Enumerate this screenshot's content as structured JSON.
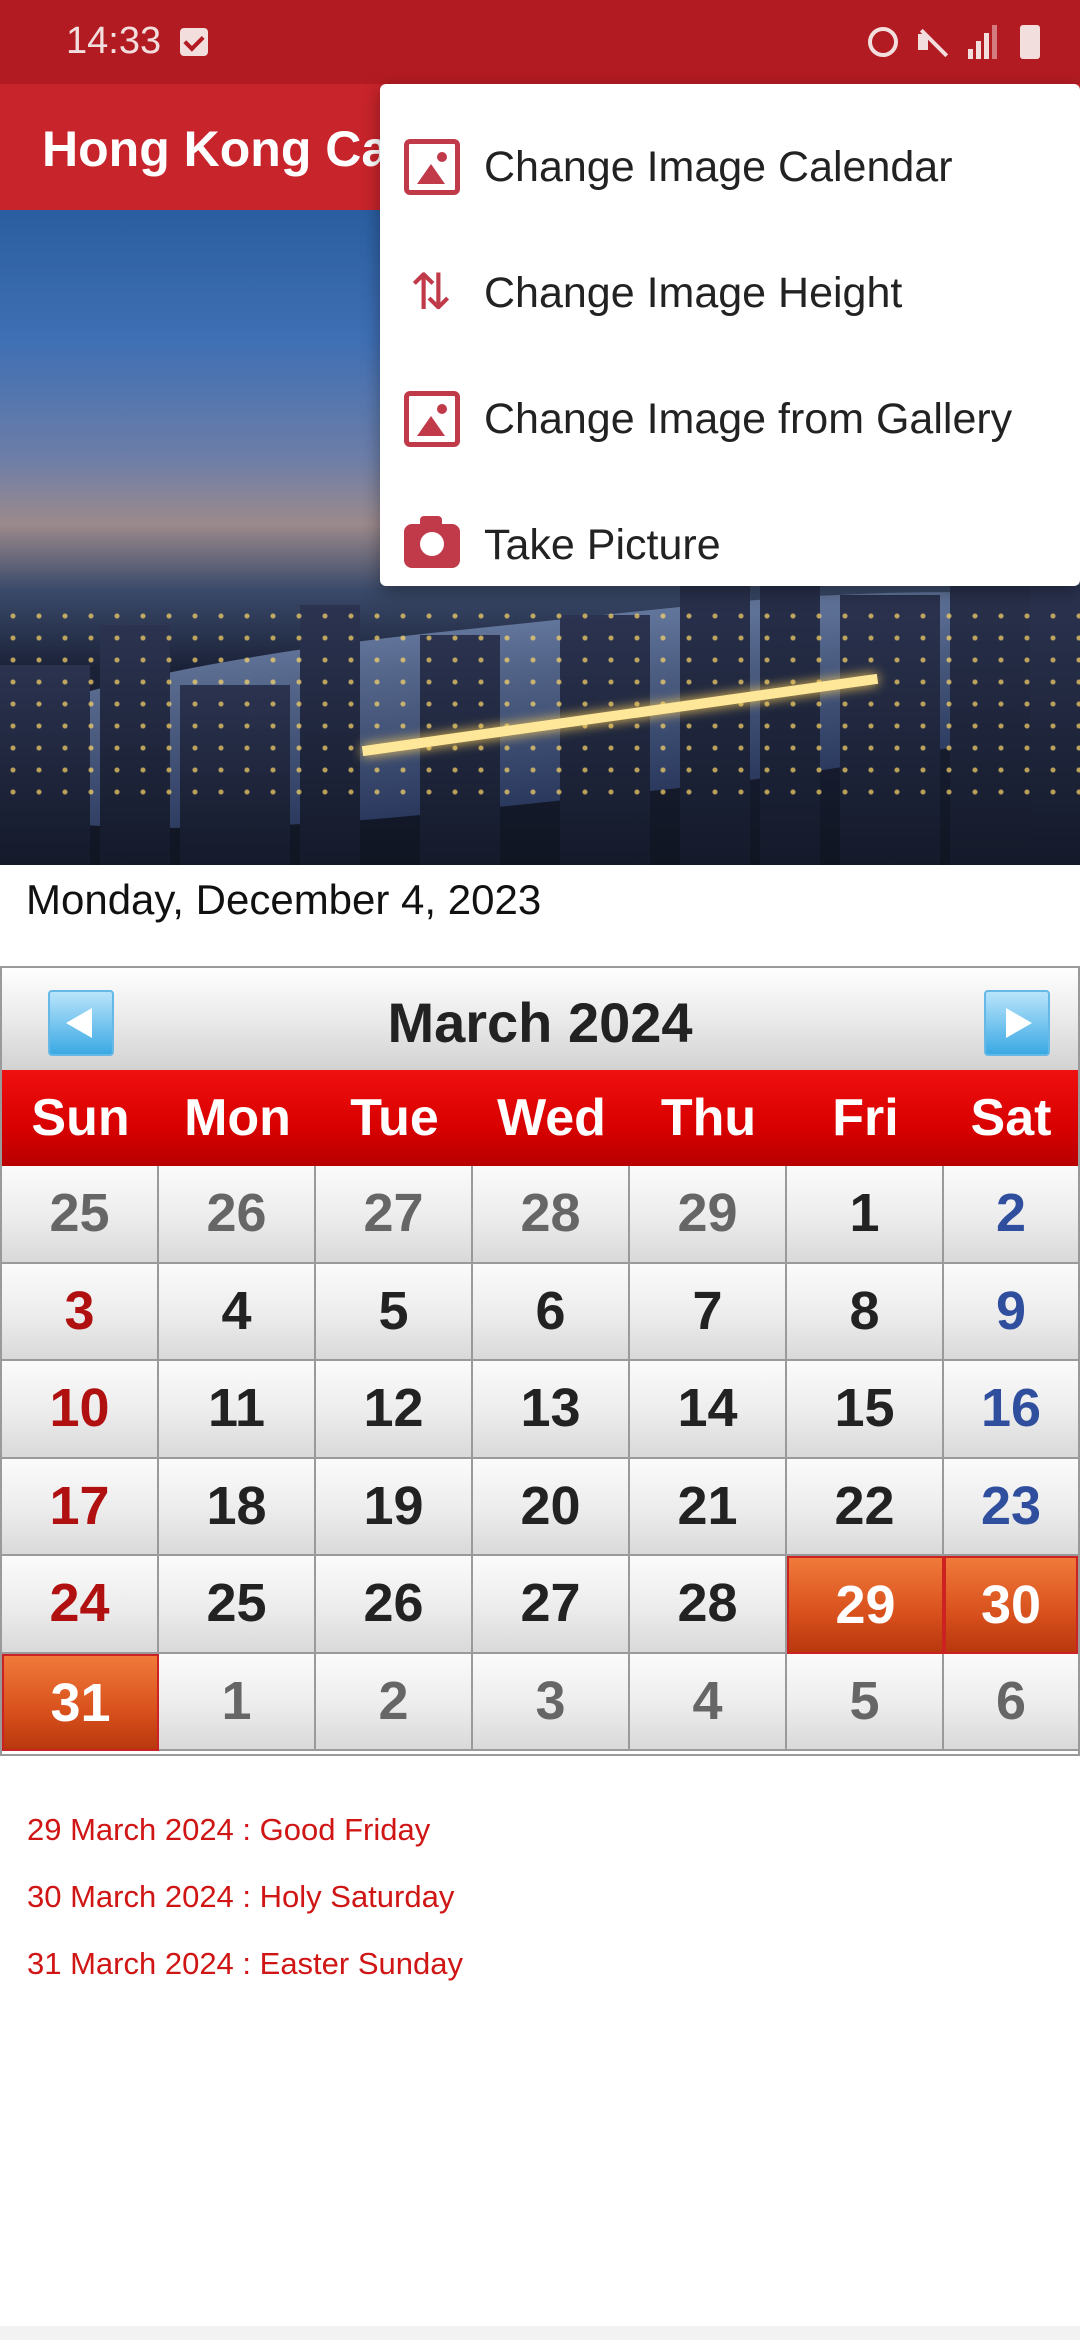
{
  "status_bar": {
    "time": "14:33"
  },
  "app_bar": {
    "title": "Hong Kong Calendar 2024"
  },
  "menu": {
    "items": [
      {
        "label": "Change Image Calendar",
        "icon": "image-icon"
      },
      {
        "label": "Change Image Height",
        "icon": "swap-vertical-icon"
      },
      {
        "label": "Change Image from Gallery",
        "icon": "image-icon"
      },
      {
        "label": "Take Picture",
        "icon": "camera-icon"
      }
    ]
  },
  "today_label": "Monday, December 4, 2023",
  "calendar": {
    "month_title": "March  2024",
    "weekdays": [
      "Sun",
      "Mon",
      "Tue",
      "Wed",
      "Thu",
      "Fri",
      "Sat"
    ],
    "weeks": [
      [
        "25",
        "26",
        "27",
        "28",
        "29",
        "1",
        "2"
      ],
      [
        "3",
        "4",
        "5",
        "6",
        "7",
        "8",
        "9"
      ],
      [
        "10",
        "11",
        "12",
        "13",
        "14",
        "15",
        "16"
      ],
      [
        "17",
        "18",
        "19",
        "20",
        "21",
        "22",
        "23"
      ],
      [
        "24",
        "25",
        "26",
        "27",
        "28",
        "29",
        "30"
      ],
      [
        "31",
        "1",
        "2",
        "3",
        "4",
        "5",
        "6"
      ]
    ]
  },
  "holidays": [
    "29 March 2024 : Good Friday",
    "30 March 2024 : Holy Saturday",
    "31 March 2024 : Easter Sunday"
  ],
  "colors": {
    "status_bar": "#b31b22",
    "app_bar": "#c8242b",
    "weekday_header": "#d80000",
    "holiday_cell": "#d8501c",
    "holiday_text": "#d01515",
    "saturday_text": "#2f4f9e",
    "sunday_text": "#b01010"
  }
}
